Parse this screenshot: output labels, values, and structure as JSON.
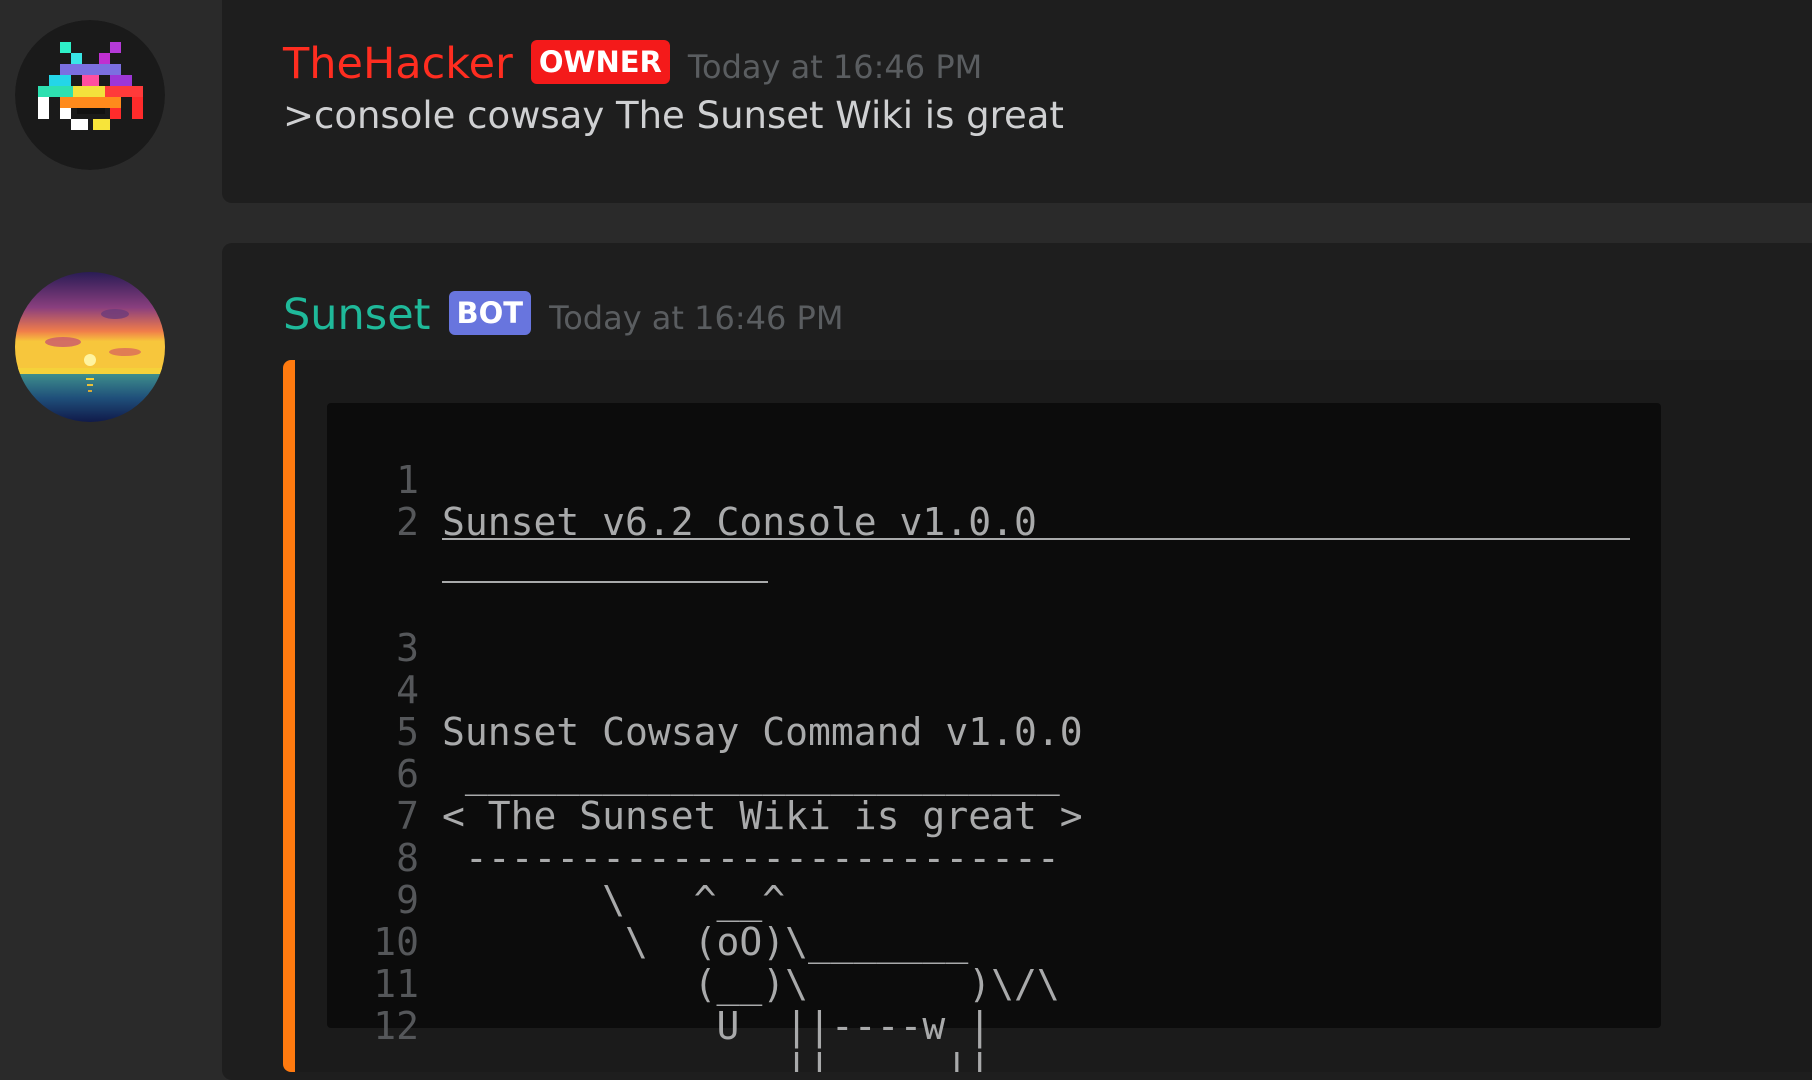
{
  "messages": [
    {
      "username": "TheHacker",
      "badge": "OWNER",
      "timestamp": "Today at 16:46 PM",
      "text": ">console cowsay The Sunset Wiki is great"
    },
    {
      "username": "Sunset",
      "badge": "BOT",
      "timestamp": "Today at 16:46 PM",
      "embed": {
        "accent_color": "#ff7a0f",
        "code_lines": [
          {
            "num": "1",
            "text": "Sunset v6.2 Console v1.0.0"
          },
          {
            "num": "2",
            "text": ""
          },
          {
            "num": "3",
            "text": ""
          },
          {
            "num": "4",
            "text": "Sunset Cowsay Command v1.0.0"
          },
          {
            "num": "5",
            "text": " __________________________"
          },
          {
            "num": "6",
            "text": "< The Sunset Wiki is great >"
          },
          {
            "num": "7",
            "text": " --------------------------"
          },
          {
            "num": "8",
            "text": "       \\   ^__^"
          },
          {
            "num": "9",
            "text": "        \\  (oO)\\_______"
          },
          {
            "num": "10",
            "text": "           (__)\\       )\\/\\"
          },
          {
            "num": "11",
            "text": "            U  ||----w |"
          },
          {
            "num": "12",
            "text": "               ||     ||"
          }
        ]
      }
    }
  ],
  "colors": {
    "owner_name": "#ff2d20",
    "owner_badge": "#f41a1a",
    "bot_name": "#1fb99a",
    "bot_badge": "#6875de"
  },
  "icons": {
    "hacker_avatar": "space-invader-avatar-icon",
    "sunset_avatar": "sunset-avatar-icon"
  }
}
